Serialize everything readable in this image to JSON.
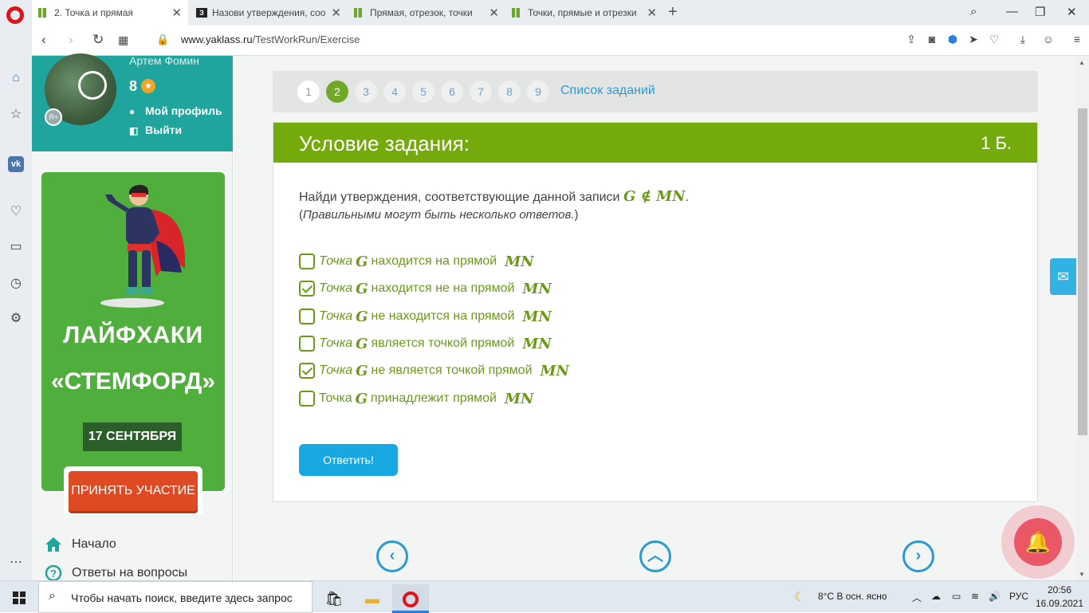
{
  "browser": {
    "tabs": [
      {
        "label": "2. Точка и прямая",
        "favicon": "yaklass-icon",
        "active": true
      },
      {
        "label": "Назови утверждения, соо",
        "favicon": "znanija-icon",
        "active": false
      },
      {
        "label": "Прямая, отрезок, точки",
        "favicon": "yaklass-icon",
        "active": false
      },
      {
        "label": "Точки, прямые и отрезки",
        "favicon": "yaklass-icon",
        "active": false
      }
    ],
    "url_domain": "www.yaklass.ru",
    "url_path": "/TestWorkRun/Exercise"
  },
  "user": {
    "name": "Артем Фомин",
    "points": "8",
    "profile_link": "Мой профиль",
    "logout_link": "Выйти"
  },
  "promo": {
    "title_line1": "ЛАЙФХАКИ",
    "title_line2": "«СТЕМФОРД»",
    "date": "17 СЕНТЯБРЯ",
    "button": "ПРИНЯТЬ УЧАСТИЕ"
  },
  "nav": {
    "home": "Начало",
    "answers": "Ответы на вопросы"
  },
  "pager": {
    "pages": [
      "1",
      "2",
      "3",
      "4",
      "5",
      "6",
      "7",
      "8",
      "9"
    ],
    "current": "2",
    "list_link": "Список заданий"
  },
  "task": {
    "header": "Условие задания:",
    "points": "1 Б.",
    "prompt": "Найди утверждения, соответствующие данной записи ",
    "formula": "G ∉ MN",
    "prompt_end": ".",
    "hint_open": "(",
    "hint": "Правильными могут быть несколько ответов.",
    "hint_close": ")",
    "options": [
      {
        "lead": "Точка",
        "lead_italic": true,
        "var": "G",
        "text": "находится на прямой",
        "line": "MN",
        "checked": false
      },
      {
        "lead": "Точка",
        "lead_italic": true,
        "var": "G",
        "text": "находится не на прямой",
        "line": "MN",
        "checked": true
      },
      {
        "lead": "Точка",
        "lead_italic": true,
        "var": "G",
        "text": "не находится на прямой",
        "line": "MN",
        "checked": false
      },
      {
        "lead": "Точка",
        "lead_italic": true,
        "var": "G",
        "text": "является точкой прямой",
        "line": "MN",
        "checked": false
      },
      {
        "lead": "Точка",
        "lead_italic": true,
        "var": "G",
        "text": "не является точкой прямой",
        "line": "MN",
        "checked": true
      },
      {
        "lead": "Точка",
        "lead_italic": false,
        "var": "G",
        "text": "принадлежит прямой",
        "line": "MN",
        "checked": false
      }
    ],
    "submit": "Ответить!"
  },
  "taskbar": {
    "search_placeholder": "Чтобы начать поиск, введите здесь запрос",
    "weather": "8°C  В осн. ясно",
    "lang": "РУС",
    "time": "20:56",
    "date": "16.09.2021"
  },
  "colors": {
    "accent_green": "#74aa0c",
    "teal": "#1fa59d",
    "link_blue": "#2b9ad4",
    "submit_blue": "#17a7e3",
    "promo_green": "#4fae3c",
    "promo_red": "#dd4a24"
  }
}
